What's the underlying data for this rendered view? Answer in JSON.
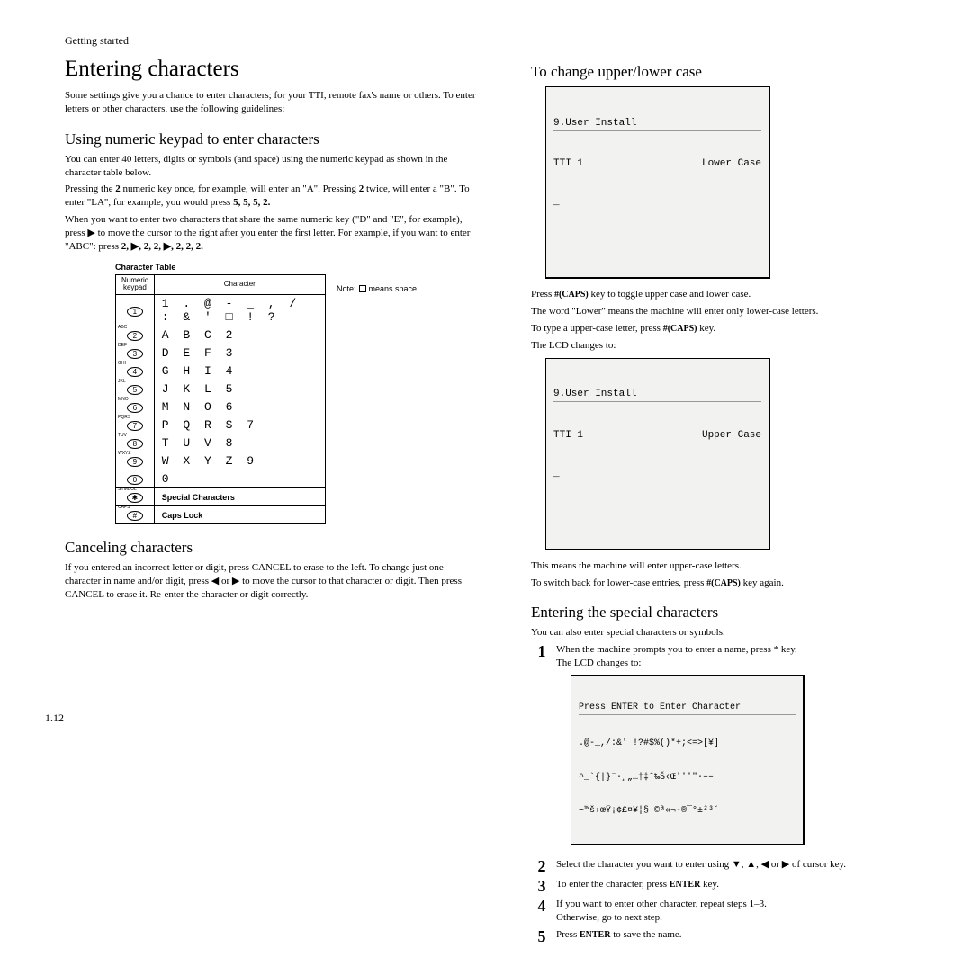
{
  "breadcrumb": "Getting started",
  "page_number": "1.12",
  "left": {
    "h1": "Entering characters",
    "intro": "Some settings give you a chance to enter characters; for your TTI, remote fax's name or others. To enter letters or other characters, use the following guidelines:",
    "sec1_h": "Using numeric keypad to enter characters",
    "sec1_p1": "You can enter 40 letters, digits or symbols (and space) using the numeric keypad as shown in the character table below.",
    "sec1_p2a": "Pressing the ",
    "sec1_p2b": " numeric key once, for example, will enter an \"A\". Pressing ",
    "sec1_p2c": " twice, will enter a \"B\". To enter \"LA\", for example, you would press ",
    "sec1_p2d": "5, 5, 5, 2.",
    "sec1_p3a": "When you want to enter two characters that share the same numeric key (\"D\" and \"E\", for example), press ▶ to move the cursor to the right after you enter the first letter. For example, if you want to enter \"ABC\": press ",
    "sec1_p3b": "2, ▶, 2, 2, ▶, 2, 2, 2.",
    "table_title": "Character Table",
    "table_head_left": "Numeric keypad",
    "table_head_right": "Character",
    "note_a": "Note:",
    "note_b": "means space.",
    "rows": [
      {
        "label": "",
        "key": "1",
        "chars": "1 . @ - _ , / : & ' □ ! ?"
      },
      {
        "label": "ABC",
        "key": "2",
        "chars": "A B C 2"
      },
      {
        "label": "DEF",
        "key": "3",
        "chars": "D E F 3"
      },
      {
        "label": "GHI",
        "key": "4",
        "chars": "G H I 4"
      },
      {
        "label": "JKL",
        "key": "5",
        "chars": "J K L 5"
      },
      {
        "label": "MNO",
        "key": "6",
        "chars": "M N O 6"
      },
      {
        "label": "PQRS",
        "key": "7",
        "chars": "P Q R S 7"
      },
      {
        "label": "TUV",
        "key": "8",
        "chars": "T U V 8"
      },
      {
        "label": "WXYZ",
        "key": "9",
        "chars": "W X Y Z 9"
      },
      {
        "label": "",
        "key": "0",
        "chars": "0"
      },
      {
        "label": "SYMBOL",
        "key": "✱",
        "chars": "Special Characters"
      },
      {
        "label": "CAPS",
        "key": "#",
        "chars": "Caps Lock"
      }
    ],
    "sec2_h": "Canceling characters",
    "sec2_p": "If you entered an incorrect letter or digit, press CANCEL to erase to the left. To change just one character in name and/or digit, press ◀ or ▶ to move the cursor to that character or digit. Then press CANCEL to erase it. Re-enter the character or digit correctly."
  },
  "right": {
    "sec3_h": "To change upper/lower case",
    "lcd1_top": "9.User Install",
    "lcd1_l": "TTI 1",
    "lcd1_r": "Lower Case",
    "lcd1_cur": "_",
    "sec3_p1a": "Press ",
    "sec3_p1b": "#(CAPS)",
    "sec3_p1c": " key to toggle upper case and lower case.",
    "sec3_p2": "The word \"Lower\" means the machine will enter only lower-case letters.",
    "sec3_p3a": "To type a upper-case letter, press ",
    "sec3_p3b": "#(CAPS)",
    "sec3_p3c": " key.",
    "sec3_p4a": "The ",
    "sec3_p4b": "LCD",
    "sec3_p4c": " changes to:",
    "lcd2_top": "9.User Install",
    "lcd2_l": "TTI 1",
    "lcd2_r": "Upper Case",
    "lcd2_cur": "_",
    "sec3_p5": "This means the machine will enter upper-case letters.",
    "sec3_p6a": "To switch back for lower-case entries, press ",
    "sec3_p6b": "#(CAPS)",
    "sec3_p6c": " key again.",
    "sec4_h": "Entering the special characters",
    "sec4_p1": "You can also enter special characters or symbols.",
    "step1a": "When the machine prompts you to enter a name, press * key.",
    "step1b": "The LCD changes to:",
    "lcd3_top": "Press ENTER to Enter Character",
    "lcd3_l1": ".@-_,/:&' !?#$%()*+;<=>[¥]",
    "lcd3_l2": "^_`{|}¨·¸„…†‡ˆ‰Š‹Œ'''\"·––",
    "lcd3_l3": "~™š›œŸ¡¢£¤¥¦§ ©ª«¬-®¯°±²³´",
    "step2": "Select the character you want to enter using ▼, ▲, ◀ or ▶ of cursor key.",
    "step3a": "To enter the character, press ",
    "step3b": "ENTER",
    "step3c": " key.",
    "step4a": "If you want to enter other character, repeat steps 1–3.",
    "step4b": "Otherwise, go to next step.",
    "step5a": "Press ",
    "step5b": "ENTER",
    "step5c": " to save the name."
  }
}
